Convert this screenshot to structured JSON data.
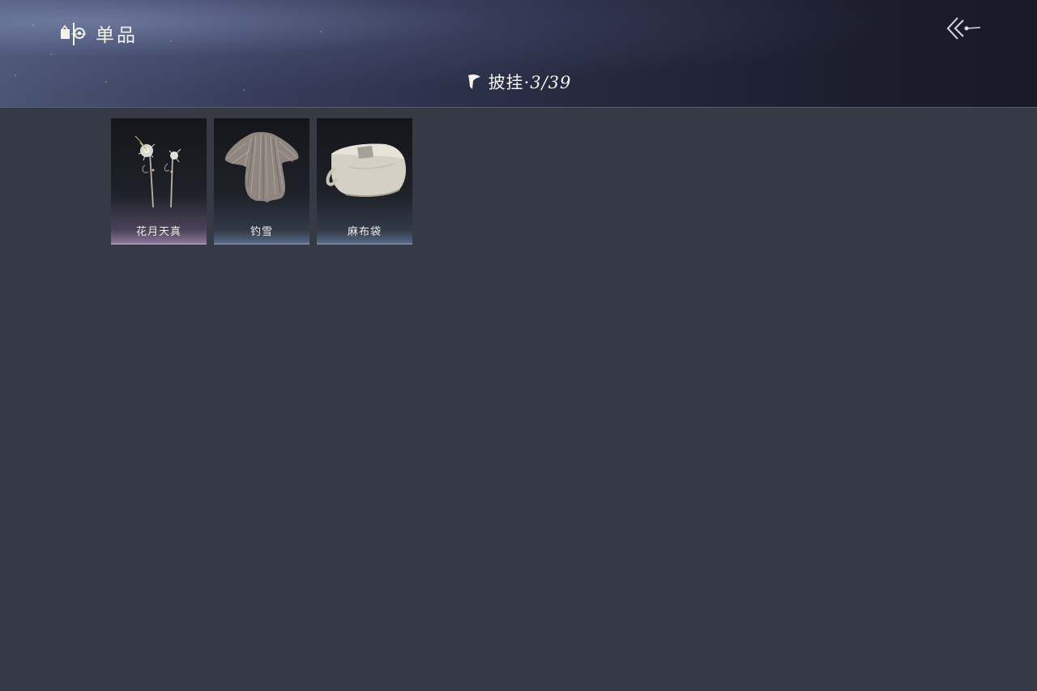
{
  "header": {
    "title": "单品",
    "title_icon": "wardrobe-icon",
    "back_icon": "back-arrow-icon"
  },
  "category": {
    "name": "披挂",
    "separator": "·",
    "count": "3/39",
    "icon": "cape-icon"
  },
  "items": [
    {
      "name": "花月天真",
      "rarity": "purple",
      "icon": "hairpin-pair-icon"
    },
    {
      "name": "钓雪",
      "rarity": "blue",
      "icon": "straw-cape-icon"
    },
    {
      "name": "麻布袋",
      "rarity": "blue",
      "icon": "sack-icon"
    }
  ],
  "colors": {
    "background": "#363a44",
    "text": "#f3f1ea",
    "rarity_purple": "#a98fb8",
    "rarity_blue": "#6f86a8"
  }
}
